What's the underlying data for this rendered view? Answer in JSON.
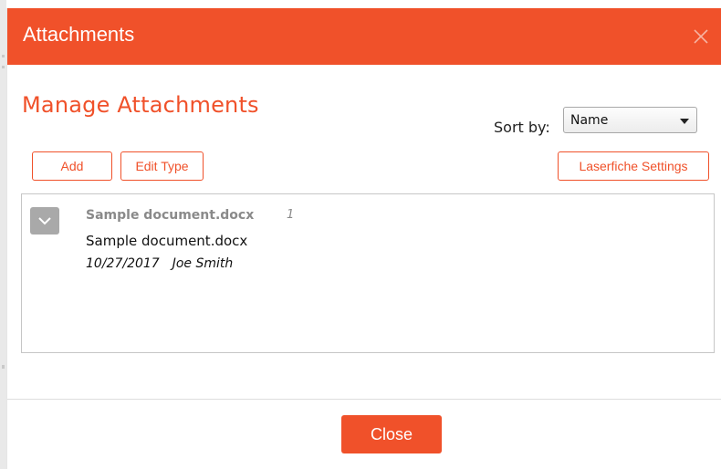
{
  "dialog": {
    "title": "Attachments",
    "heading": "Manage Attachments",
    "accent_color": "#f0512a"
  },
  "sort": {
    "label": "Sort by:",
    "selected": "Name"
  },
  "toolbar": {
    "add_label": "Add",
    "edit_type_label": "Edit Type",
    "laserfiche_settings_label": "Laserfiche Settings"
  },
  "attachments": [
    {
      "title": "Sample document.docx",
      "count": "1",
      "name": "Sample document.docx",
      "date": "10/27/2017",
      "author": "Joe Smith"
    }
  ],
  "footer": {
    "close_label": "Close"
  },
  "icons": {
    "close": "close-icon",
    "expand": "chevron-down-icon",
    "dropdown": "caret-down-icon"
  }
}
